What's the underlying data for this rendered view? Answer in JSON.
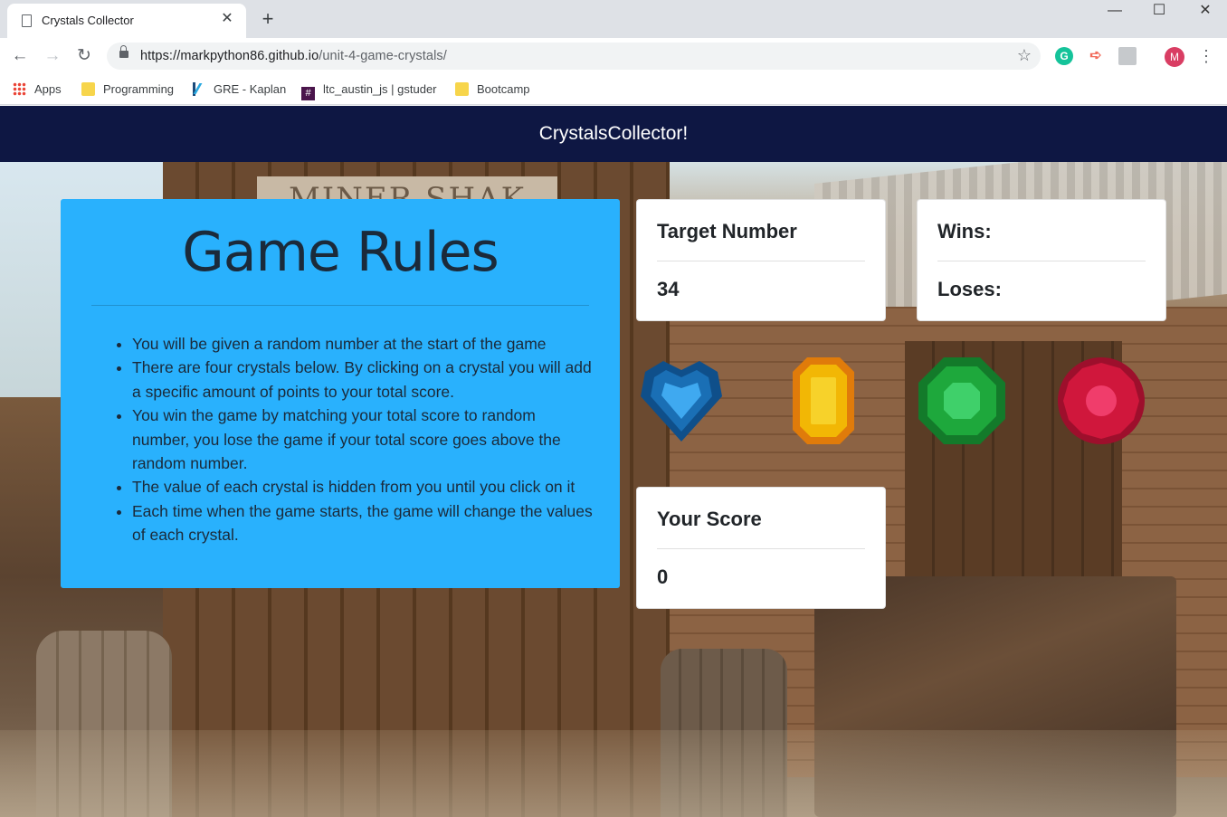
{
  "browser": {
    "tab_title": "Crystals Collector",
    "url_host": "https://markpython86.github.io",
    "url_path": "/unit-4-game-crystals/",
    "avatar_letter": "M",
    "bookmarks": [
      "Apps",
      "Programming",
      "GRE - Kaplan",
      "ltc_austin_js | gstuder",
      "Bootcamp"
    ]
  },
  "navbar": {
    "brand": "CrystalsCollector!"
  },
  "rules": {
    "title": "Game Rules",
    "items": [
      "You will be given a random number at the start of the game",
      "There are four crystals below. By clicking on a crystal you will add a specific amount of points to your total score.",
      "You win the game by matching your total score to random number, you lose the game if your total score goes above the random number.",
      "The value of each crystal is hidden from you until you click on it",
      "Each time when the game starts, the game will change the values of each crystal."
    ]
  },
  "target": {
    "label": "Target Number",
    "value": "34"
  },
  "stats": {
    "wins_label": "Wins:",
    "loses_label": "Loses:"
  },
  "score": {
    "label": "Your Score",
    "value": "0"
  },
  "crystals": [
    {
      "name": "blue",
      "color": "#1a6fb5"
    },
    {
      "name": "yellow",
      "color": "#f2b705"
    },
    {
      "name": "green",
      "color": "#1ea83c"
    },
    {
      "name": "red",
      "color": "#d0173c"
    }
  ],
  "colors": {
    "navbar": "#0e1743",
    "rules_panel": "#29b1fd"
  }
}
